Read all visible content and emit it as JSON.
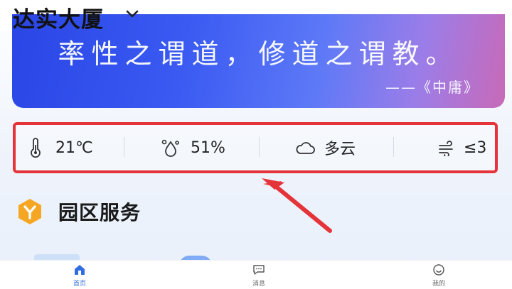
{
  "header": {
    "title": "达实大厦",
    "dropdown_icon": "chevron-down-icon"
  },
  "banner": {
    "quote": "率性之谓道，修道之谓教。",
    "source": "——《中庸》"
  },
  "weather": {
    "temperature": "21℃",
    "humidity": "51%",
    "condition": "多云",
    "wind": "≤3",
    "icons": [
      "thermometer-icon",
      "humidity-icon",
      "cloud-icon",
      "wind-icon"
    ]
  },
  "section": {
    "title": "园区服务",
    "icon": "park-service-logo-icon"
  },
  "tabbar": {
    "items": [
      {
        "label": "首页",
        "icon": "home-icon",
        "active": true
      },
      {
        "label": "消息",
        "icon": "message-icon",
        "active": false
      },
      {
        "label": "我的",
        "icon": "profile-icon",
        "active": false
      }
    ]
  },
  "colors": {
    "accent_blue": "#2f6de0",
    "highlight_red": "#e5333a",
    "banner_start": "#2a46e6",
    "banner_end": "#c86ab8",
    "section_icon": "#f5a623"
  }
}
